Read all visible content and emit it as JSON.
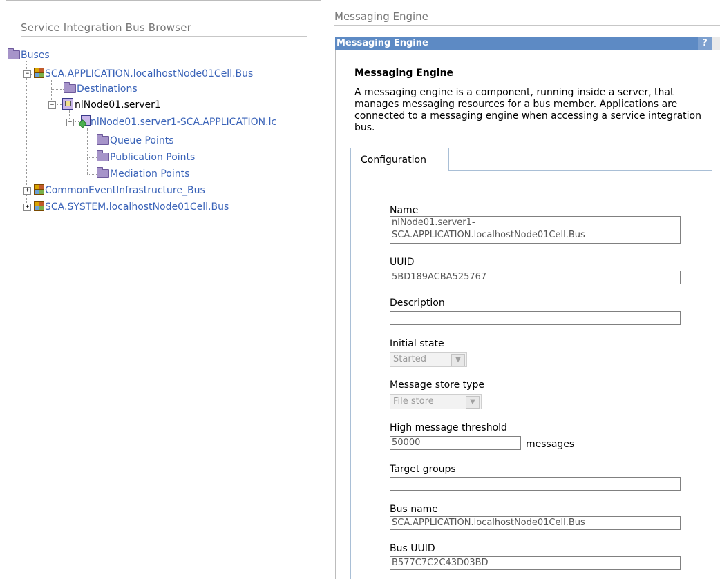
{
  "left_panel": {
    "title": "Service Integration Bus Browser",
    "tree": {
      "root": "Buses",
      "bus1": "SCA.APPLICATION.localhostNode01Cell.Bus",
      "destinations": "Destinations",
      "server": "nlNode01.server1",
      "engine": "nlNode01.server1-SCA.APPLICATION.lc",
      "queue_points": "Queue Points",
      "publication_points": "Publication Points",
      "mediation_points": "Mediation Points",
      "bus2": "CommonEventInfrastructure_Bus",
      "bus3": "SCA.SYSTEM.localhostNode01Cell.Bus",
      "expand_minus": "−",
      "expand_plus": "+"
    }
  },
  "right_panel": {
    "breadcrumb": "Messaging Engine",
    "titlebar": {
      "title": "Messaging Engine",
      "help": "?"
    },
    "heading": "Messaging Engine",
    "description": "A messaging engine is a component, running inside a server, that manages messaging resources for a bus member. Applications are connected to a messaging engine when accessing a service integration bus.",
    "tab": "Configuration",
    "fields": {
      "name_label": "Name",
      "name_value": "nlNode01.server1-\nSCA.APPLICATION.localhostNode01Cell.Bus",
      "uuid_label": "UUID",
      "uuid_value": "5BD189ACBA525767",
      "description_label": "Description",
      "description_value": "",
      "initial_state_label": "Initial state",
      "initial_state_value": "Started",
      "store_type_label": "Message store type",
      "store_type_value": "File store",
      "threshold_label": "High message threshold",
      "threshold_value": "50000",
      "threshold_unit": "messages",
      "target_groups_label": "Target groups",
      "target_groups_value": "",
      "bus_name_label": "Bus name",
      "bus_name_value": "SCA.APPLICATION.localhostNode01Cell.Bus",
      "bus_uuid_label": "Bus UUID",
      "bus_uuid_value": "B577C7C2C43D03BD"
    }
  },
  "colors": {
    "link": "#3a63b8",
    "titlebar": "#5d8ac4",
    "folder": "#a694c9"
  }
}
